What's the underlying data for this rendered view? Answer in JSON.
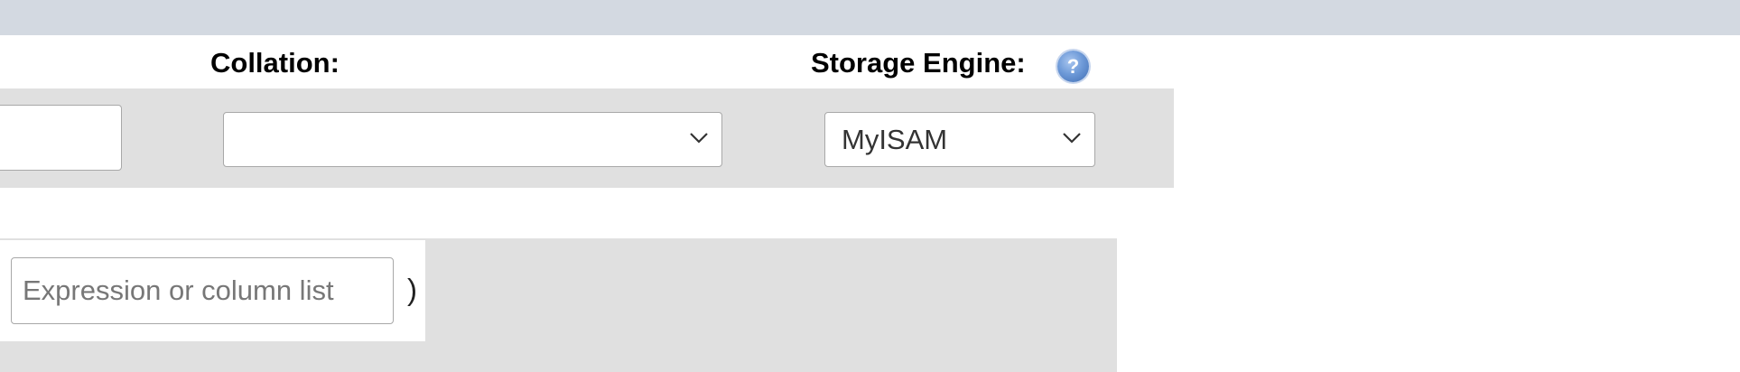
{
  "labels": {
    "collation": "Collation:",
    "storage_engine": "Storage Engine:"
  },
  "help_icon": {
    "icon": "help-icon",
    "glyph": "?"
  },
  "collation_select": {
    "value": ""
  },
  "storage_engine_select": {
    "value": "MyISAM"
  },
  "partition": {
    "expression_placeholder": "Expression or column list",
    "closing_paren": ")"
  }
}
